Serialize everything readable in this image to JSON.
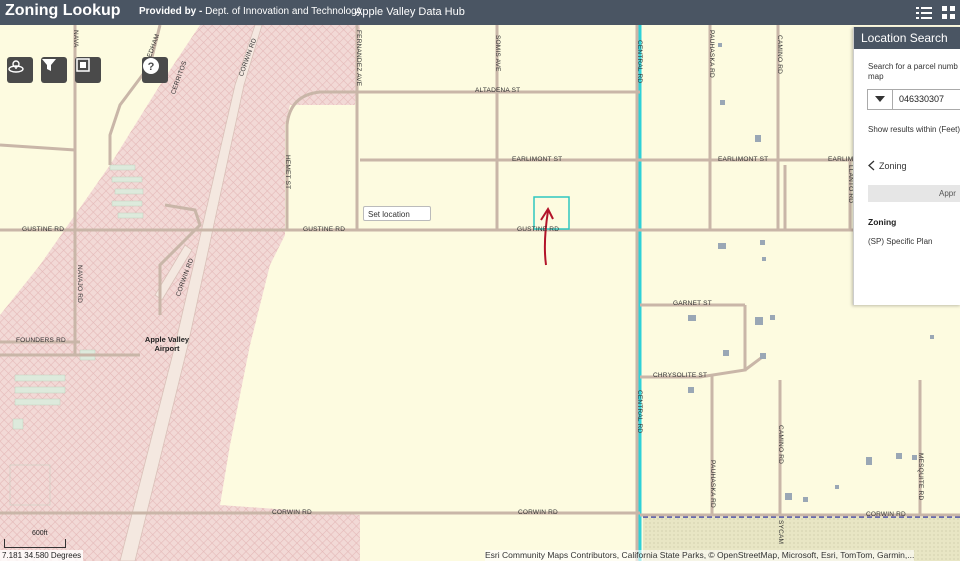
{
  "header": {
    "app_title": "Zoning Lookup",
    "provided_by_label": "Provided by -",
    "provided_by_dept": "Dept. of Innovation and Technology",
    "hub_name": "Apple Valley Data Hub",
    "icons": [
      "list-icon",
      "grid-icon"
    ]
  },
  "toolbar": {
    "icons": [
      "basemap-icon",
      "filter-icon",
      "export-icon",
      "help-icon"
    ]
  },
  "map": {
    "roads": {
      "altadena": "ALTADENA ST",
      "earlimont_left": "EARLIMONT ST",
      "earlimont_right": "EARLIMONT ST",
      "earlimont_far": "EARLIMO",
      "gustine_left": "GUSTINE RD",
      "gustine_mid": "GUSTINE RD",
      "gustine_right": "GUSTINE RD",
      "founders": "FOUNDERS RD",
      "corwin_left": "CORWIN RD",
      "corwin_mid": "CORWIN RD",
      "corwin_right": "CORWIN RD",
      "corwin_vert1": "CORWIN RD",
      "corwin_vert2": "CORWIN RD",
      "navajo": "NAVAJO RD",
      "fernandez": "FERNANDEZ AVE",
      "somis": "SOMIS AVE",
      "hemet": "HEMET ST",
      "central_top": "CENTRAL RD",
      "central_bottom": "CENTRAL RD",
      "pauhaska_top": "PAUHASKA RD",
      "pauhaska_bottom": "PAUHASKA RD",
      "camino_top": "CAMINO RD",
      "camino_bottom": "CAMINO RD",
      "llanto": "LLANTO RD",
      "garnet": "GARNET ST",
      "chrysolite": "CHRYSOLITE ST",
      "mesquite": "MESQUITE RD",
      "sycam": "SYCAM",
      "navaj_top": "NAVA",
      "needham": "NEEDHAM",
      "cerritos": "CERRITOS"
    },
    "airport_label_line1": "Apple Valley",
    "airport_label_line2": "Airport",
    "set_location_label": "Set location",
    "scale_label": "600ft",
    "coordinates": "7.181 34.580 Degrees",
    "attribution": "Esri Community Maps Contributors, California State Parks, © OpenStreetMap, Microsoft, Esri, TomTom, Garmin,...",
    "colors": {
      "background": "#fdfbe0",
      "airport_zone": "#f2d9d6",
      "road": "#c9b6a8",
      "boundary": "#2ed1d8",
      "selection": "#2ec7c0",
      "arrow": "#b3142a"
    }
  },
  "panel": {
    "title": "Location Search",
    "search_hint_line1": "Search for a parcel numb",
    "search_hint_line2": "map",
    "parcel_value": "046330307",
    "show_results_label": "Show results within (Feet)",
    "zoning_nav_label": "Zoning",
    "apply_label": "Appr",
    "zoning_heading": "Zoning",
    "zoning_value": "(SP) Specific Plan"
  }
}
